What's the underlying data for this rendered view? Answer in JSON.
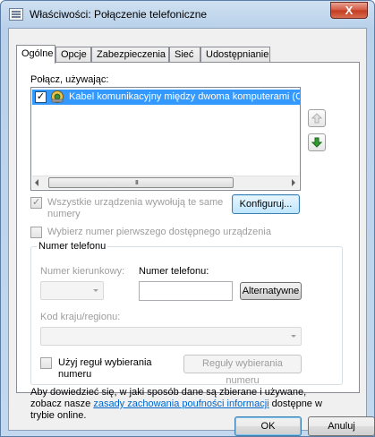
{
  "window": {
    "title": "Właściwości: Połączenie telefoniczne",
    "close_glyph": "X"
  },
  "tabs": [
    {
      "label": "Ogólne",
      "active": true
    },
    {
      "label": "Opcje",
      "active": false
    },
    {
      "label": "Zabezpieczenia",
      "active": false
    },
    {
      "label": "Sieć",
      "active": false
    },
    {
      "label": "Udostępnianie",
      "active": false
    }
  ],
  "general": {
    "connect_using_label": "Połącz, używając:",
    "devices": [
      {
        "label": "Kabel komunikacyjny między dwoma komputerami (C",
        "checked": true,
        "selected": true
      }
    ],
    "scroll_grip": "III",
    "all_devices_line1": "Wszystkie urządzenia wywołują te same",
    "all_devices_line2": "numery",
    "configure_button": "Konfiguruj...",
    "first_number_label": "Wybierz numer pierwszego dostępnego urządzenia",
    "phone_group": {
      "legend": "Numer telefonu",
      "area_code_label": "Numer kierunkowy:",
      "phone_number_label": "Numer telefonu:",
      "phone_number_value": "",
      "alternatives_button": "Alternatywne",
      "country_label": "Kod kraju/regionu:",
      "dialing_rules_line1": "Użyj reguł wybierania",
      "dialing_rules_line2": "numeru",
      "dialing_rules_button": "Reguły wybierania numeru"
    },
    "privacy": {
      "text_before": "Aby dowiedzieć się, w jaki sposób dane są zbierane i używane, zobacz nasze ",
      "link": "zasady zachowania poufności informacji",
      "text_after": " dostępne w trybie online."
    }
  },
  "buttons": {
    "ok": "OK",
    "cancel": "Anuluj"
  },
  "colors": {
    "selection": "#3399ff",
    "link": "#0066cc",
    "close": "#c23a1f"
  }
}
